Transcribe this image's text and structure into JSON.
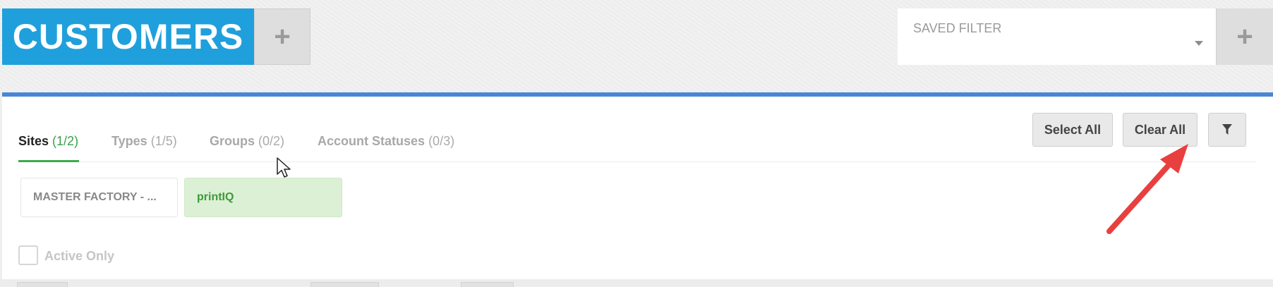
{
  "header": {
    "title": "CUSTOMERS",
    "add_label": "+",
    "saved_filter_placeholder": "SAVED FILTER",
    "saved_filter_add_label": "+"
  },
  "tabs": [
    {
      "label": "Sites",
      "count": "(1/2)",
      "active": true
    },
    {
      "label": "Types",
      "count": "(1/5)",
      "active": false
    },
    {
      "label": "Groups",
      "count": "(0/2)",
      "active": false
    },
    {
      "label": "Account Statuses",
      "count": "(0/3)",
      "active": false
    }
  ],
  "actions": {
    "select_all": "Select All",
    "clear_all": "Clear All"
  },
  "chips": [
    {
      "label": "MASTER FACTORY - ...",
      "selected": false
    },
    {
      "label": "printIQ",
      "selected": true
    }
  ],
  "active_only": {
    "label": "Active Only",
    "checked": false
  },
  "icons": {
    "filter": "filter-icon",
    "caret": "chevron-down-icon",
    "pointer": "mouse-cursor-icon",
    "annotation": "red-arrow-annotation"
  },
  "colors": {
    "brand": "#1fa0dc",
    "rule": "#4a86d6",
    "active_tab_accent": "#3cab4a",
    "selected_chip_bg": "#dcf0d6",
    "annotation_arrow": "#e8403f"
  }
}
